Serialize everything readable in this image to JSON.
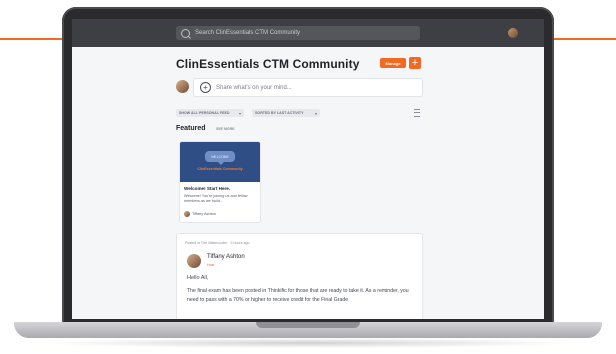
{
  "app": {
    "search_placeholder": "Search ClinEssentials CTM Community",
    "page_title": "ClinEssentials CTM Community",
    "manage_label": "Manage",
    "add_symbol": "+",
    "composer_placeholder": "Share what's on your mind...",
    "composer_icon": "+"
  },
  "filters": [
    {
      "label": "SHOW ALL PERSONAL FEED",
      "chevron": "▾"
    },
    {
      "label": "SORTED BY LAST ACTIVITY",
      "chevron": "▾"
    }
  ],
  "featured": {
    "heading": "Featured",
    "see_more": "SEE MORE",
    "card": {
      "bubble_text": "WELCOME",
      "banner_text": "ClinEssentials Community",
      "title": "Welcome! Start Here.",
      "excerpt": "Welcome! You're joining us and fellow members as we build...",
      "author": "Tiffany Ashton"
    }
  },
  "post": {
    "meta": "Posted in The Watercooler · 3 hours ago",
    "author": "Tiffany Ashton",
    "role": "Host",
    "greeting": "Hello All,",
    "body": "The final exam has been posted in Thinkific for those that are ready to take it. As a reminder, you need to pass with a 70% or higher to receive credit for the Final Grade"
  },
  "colors": {
    "accent": "#f26a21",
    "topbar": "#3d3f45",
    "banner": "#2f4e86"
  },
  "icons": {
    "search": "search-icon",
    "add": "plus-icon",
    "view_toggle": "list-view-icon"
  }
}
